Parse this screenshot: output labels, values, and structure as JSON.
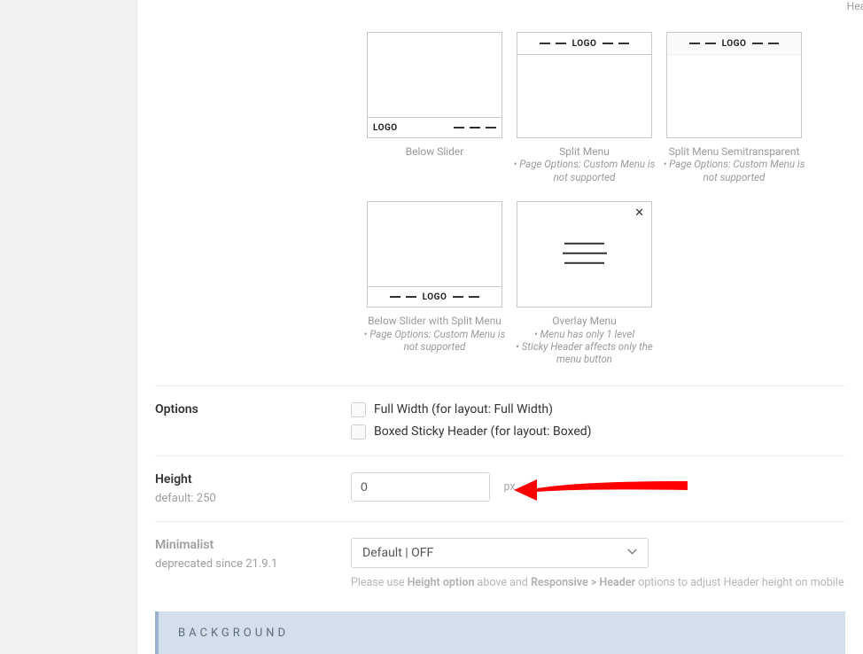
{
  "top_caption": "Header",
  "layouts_row1": [
    {
      "label": "Below Slider",
      "note": "",
      "type": "bottom-left-logo"
    },
    {
      "label": "Split Menu",
      "note": "• Page Options: Custom Menu is not supported",
      "type": "top-center-logo"
    },
    {
      "label": "Split Menu Semitransparent",
      "note": "• Page Options: Custom Menu is not supported",
      "type": "top-center-logo-semit"
    }
  ],
  "layouts_row2": [
    {
      "label": "Below Slider with Split Menu",
      "note": "• Page Options: Custom Menu is not supported",
      "type": "bottom-center-logo"
    },
    {
      "label": "Overlay Menu",
      "note_ml": "• Menu has only 1 level\n• Sticky Header affects only the menu button",
      "type": "overlay"
    }
  ],
  "logo_text": "LOGO",
  "options": {
    "label": "Options",
    "full_width": "Full Width (for layout: Full Width)",
    "boxed_sticky": "Boxed Sticky Header (for layout: Boxed)"
  },
  "height": {
    "label": "Height",
    "default_text": "default: 250",
    "value": "0",
    "unit": "px"
  },
  "minimalist": {
    "label": "Minimalist",
    "deprecated": "deprecated since 21.9.1",
    "select_value": "Default | OFF",
    "help_pre": "Please use ",
    "help_b1": "Height option",
    "help_mid": " above and ",
    "help_b2": "Responsive > Header",
    "help_post": " options to adjust Header height on mobile"
  },
  "section_title": "BACKGROUND"
}
